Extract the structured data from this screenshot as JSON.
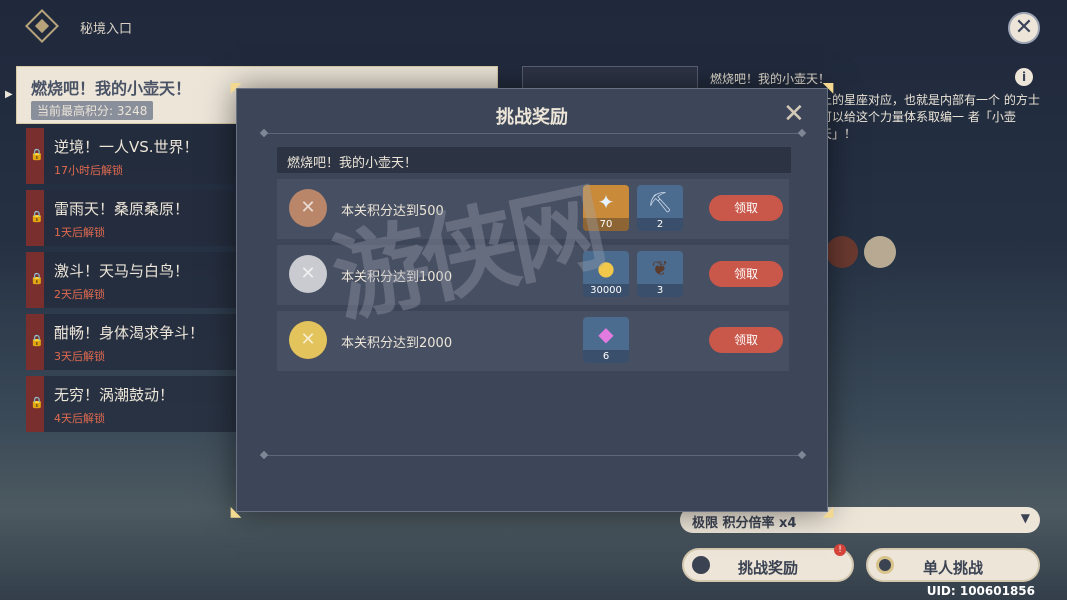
{
  "header": {
    "breadcrumb": "秘境入口"
  },
  "domains": [
    {
      "name": "燃烧吧！我的小壶天！",
      "status": "当前最高积分: 3248",
      "active": true
    },
    {
      "name": "逆境！一人VS.世界！",
      "status": "17小时后解锁"
    },
    {
      "name": "雷雨天！桑原桑原！",
      "status": "1天后解锁"
    },
    {
      "name": "激斗！天马与白鸟！",
      "status": "2天后解锁"
    },
    {
      "name": "酣畅！身体渴求争斗！",
      "status": "3天后解锁"
    },
    {
      "name": "无穷！涡潮鼓动！",
      "status": "4天后解锁"
    }
  ],
  "detail": {
    "title": "燃烧吧！我的小壶天！",
    "description": "上的星座对应，也就是内部有一个 的方士可以给这个力量体系取编一 者「小壶天」！"
  },
  "mode_select": {
    "label": "极限 积分倍率 x4"
  },
  "buttons": {
    "rewards": "挑战奖励",
    "solo": "单人挑战",
    "rewards_badge": "!"
  },
  "uid": "UID: 100601856",
  "modal": {
    "title": "挑战奖励",
    "section": "燃烧吧！我的小壶天！",
    "tiers": [
      {
        "requirement": "本关积分达到500",
        "medal": "bronze",
        "claim": "领取",
        "rewards": [
          {
            "icon": "primogem-icon",
            "qty": "70"
          },
          {
            "icon": "ore-icon",
            "qty": "2"
          }
        ]
      },
      {
        "requirement": "本关积分达到1000",
        "medal": "silver",
        "claim": "领取",
        "rewards": [
          {
            "icon": "mora-icon",
            "qty": "30000"
          },
          {
            "icon": "branch-icon",
            "qty": "3"
          }
        ]
      },
      {
        "requirement": "本关积分达到2000",
        "medal": "gold",
        "claim": "领取",
        "rewards": [
          {
            "icon": "crystal-icon",
            "qty": "6"
          }
        ]
      }
    ]
  },
  "colors": {
    "claim": "#c9574a",
    "bronze": "#b9866a",
    "silver": "#c9cbd1",
    "gold": "#e3c35b"
  },
  "watermark": "游侠网"
}
